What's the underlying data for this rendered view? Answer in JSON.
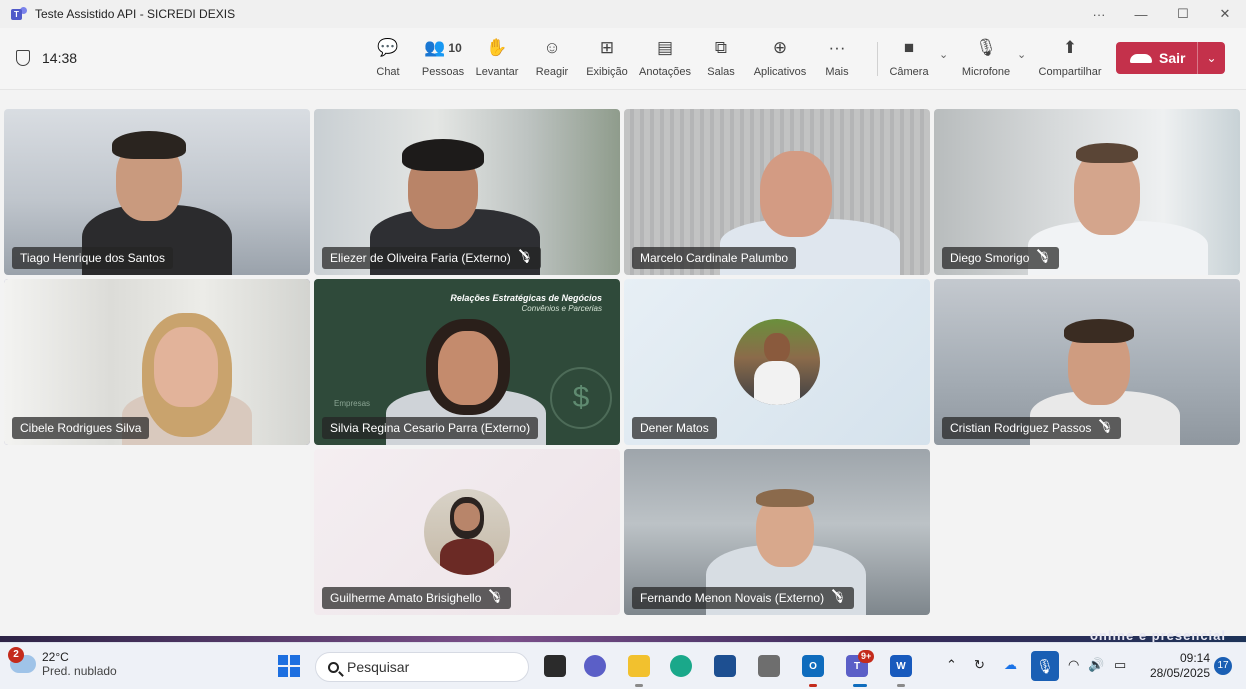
{
  "window": {
    "title": "Teste Assistido API - SICREDI DEXIS",
    "more": "···",
    "minimize": "—",
    "maximize": "☐",
    "close": "✕"
  },
  "meeting": {
    "timer": "14:38",
    "tools": [
      {
        "label": "Chat",
        "icon": "chat-icon",
        "glyph": "💬"
      },
      {
        "label": "Pessoas",
        "icon": "people-icon",
        "glyph": "👥",
        "count": "10"
      },
      {
        "label": "Levantar",
        "icon": "raise-hand-icon",
        "glyph": "✋"
      },
      {
        "label": "Reagir",
        "icon": "react-icon",
        "glyph": "☺"
      },
      {
        "label": "Exibição",
        "icon": "view-icon",
        "glyph": "⊞"
      },
      {
        "label": "Anotações",
        "icon": "notes-icon",
        "glyph": "▤"
      },
      {
        "label": "Salas",
        "icon": "rooms-icon",
        "glyph": "⧉"
      },
      {
        "label": "Aplicativos",
        "icon": "apps-icon",
        "glyph": "⊕"
      },
      {
        "label": "Mais",
        "icon": "more-icon",
        "glyph": "···"
      },
      {
        "label": "Câmera",
        "icon": "camera-icon",
        "glyph": "■"
      },
      {
        "label": "Microfone",
        "icon": "mic-icon",
        "glyph": "🎙"
      },
      {
        "label": "Compartilhar",
        "icon": "share-icon",
        "glyph": "⬆"
      }
    ],
    "leave_label": "Sair",
    "leave_color": "#c4314b"
  },
  "participants": [
    {
      "name": "Tiago Henrique dos Santos",
      "muted": false
    },
    {
      "name": "Eliezer de Oliveira Faria (Externo)",
      "muted": true
    },
    {
      "name": "Marcelo Cardinale Palumbo",
      "muted": false
    },
    {
      "name": "Diego Smorigo",
      "muted": true
    },
    {
      "name": "Cibele Rodrigues Silva",
      "muted": false,
      "active_speaker": true
    },
    {
      "name": "Silvia Regina Cesario Parra (Externo)",
      "muted": false
    },
    {
      "name": "Dener Matos",
      "muted": false
    },
    {
      "name": "Cristian Rodriguez Passos",
      "muted": true
    },
    {
      "name": "Guilherme Amato Brisighello",
      "muted": true
    },
    {
      "name": "Fernando Menon Novais (Externo)",
      "muted": true
    }
  ],
  "background_banner": {
    "title": "Relações Estratégicas de Negócios",
    "subtitle": "Convênios e Parcerias",
    "left_text": "Empresas"
  },
  "wallpaper_text": "online e presencial",
  "taskbar": {
    "weather_badge": "2",
    "temperature": "22°C",
    "condition": "Pred. nublado",
    "search_placeholder": "Pesquisar",
    "teams_badge": "9+",
    "time": "09:14",
    "date": "28/05/2025",
    "notification_count": "17"
  }
}
